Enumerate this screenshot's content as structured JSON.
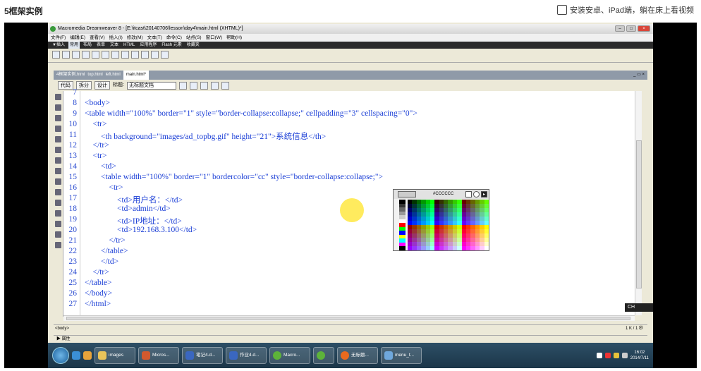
{
  "page": {
    "title": "5框架实例",
    "app_promo": "安装安卓、iPad端，躺在床上看视频"
  },
  "window": {
    "title": "Macromedia Dreamweaver 8 - [E:\\itcast\\20140706\\lesson\\day4\\main.html (XHTML)*]",
    "menu": [
      "文件(F)",
      "编辑(E)",
      "查看(V)",
      "插入(I)",
      "修改(M)",
      "文本(T)",
      "命令(C)",
      "站点(S)",
      "窗口(W)",
      "帮助(H)"
    ],
    "insert_bar": [
      "▼插入",
      "常用",
      "布局",
      "表单",
      "文本",
      "HTML",
      "应用程序",
      "Flash 元素",
      "收藏夹"
    ]
  },
  "doc_tabs": [
    "4框架实例.html",
    "top.html",
    "left.html",
    "main.html*"
  ],
  "doc_toolbar": {
    "code_btn": "代码",
    "split_btn": "拆分",
    "design_btn": "设计",
    "title_label": "标题:",
    "title_value": "无标题文档"
  },
  "editor": {
    "line_numbers": [
      "7",
      "8",
      "9",
      "10",
      "11",
      "12",
      "13",
      "14",
      "15",
      "16",
      "17",
      "18",
      "19",
      "20",
      "21",
      "22",
      "23",
      "24",
      "25",
      "26",
      "27"
    ],
    "lines": [
      "",
      "<body>",
      "<table width=\"100%\" border=\"1\" style=\"border-collapse:collapse;\" cellpadding=\"3\" cellspacing=\"0\">",
      "    <tr>",
      "        <th background=\"images/ad_topbg.gif\" height=\"21\">系统信息</th>",
      "    </tr>",
      "    <tr>",
      "        <td>",
      "        <table width=\"100%\" border=\"1\" bordercolor=\"cc\" style=\"border-collapse:collapse;\">",
      "            <tr>",
      "                <td>用户名：</td>",
      "                <td>admin</td>",
      "                <td>IP地址：</td>",
      "                <td>192.168.3.100</td>",
      "            </tr>",
      "        </table>",
      "        </td>",
      "    </tr>",
      "</table>",
      "</body>",
      "</html>"
    ]
  },
  "color_picker": {
    "hex": "#CCCCCC",
    "colors": {
      "swatch": "#CCCCCC"
    }
  },
  "status": {
    "tag": "<body>",
    "right": "1 K / 1 秒"
  },
  "props_label": "▶ 属性",
  "ime": "CH",
  "taskbar": {
    "items": [
      "images",
      "Micros...",
      "笔记4.d...",
      "作业4.d...",
      "Macro...",
      "",
      "无标题...",
      "menu_t..."
    ],
    "time": "16:02",
    "date": "2014/7/11"
  }
}
